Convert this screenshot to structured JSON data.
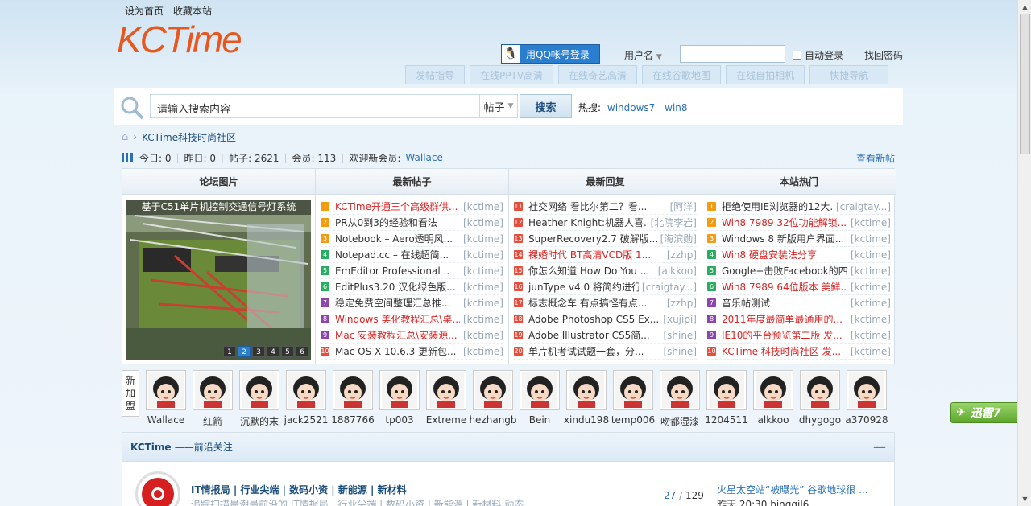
{
  "header": {
    "set_home": "设为首页",
    "bookmark": "收藏本站",
    "logo_text": "KCTime",
    "qq_login": "用QQ帐号登录",
    "username_label": "用户名",
    "auto_login": "自动登录",
    "find_password": "找回密码"
  },
  "nav": [
    "发帖指导",
    "在线PPTV高清",
    "在线奇艺高清",
    "在线谷歌地图",
    "在线自拍相机",
    "快捷导航"
  ],
  "search": {
    "placeholder": "请输入搜索内容",
    "type": "帖子",
    "button": "搜索",
    "hot_label": "热搜:",
    "hot_terms": [
      "windows7",
      "win8"
    ]
  },
  "breadcrumb": {
    "site": "KCTime科技时尚社区"
  },
  "stats": {
    "today": "今日: 0",
    "yesterday": "昨日: 0",
    "posts": "帖子: 2621",
    "members": "会员: 113",
    "welcome": "欢迎新会员:",
    "newest": "Wallace",
    "view_new": "查看新帖"
  },
  "columns": {
    "pictures": "论坛图片",
    "latest_posts": "最新帖子",
    "latest_replies": "最新回复",
    "hot": "本站热门"
  },
  "photo": {
    "caption": "基于C51单片机控制交通信号灯系统",
    "pages": [
      "1",
      "2",
      "3",
      "4",
      "5",
      "6"
    ]
  },
  "latest_posts": [
    {
      "n": "1",
      "title": "KCTime开通三个高级群供...",
      "author": "[kctime]",
      "red": true
    },
    {
      "n": "2",
      "title": "PR从0到3的经验和看法",
      "author": "[kctime]",
      "red": false
    },
    {
      "n": "3",
      "title": "Notebook – Aero透明风...",
      "author": "[kctime]",
      "red": false
    },
    {
      "n": "4",
      "title": "Notepad.cc – 在线超简...",
      "author": "[kctime]",
      "red": false
    },
    {
      "n": "5",
      "title": "EmEditor Professional ..",
      "author": "[kctime]",
      "red": false
    },
    {
      "n": "6",
      "title": "EditPlus3.20 汉化绿色版...",
      "author": "[kctime]",
      "red": false
    },
    {
      "n": "7",
      "title": "稳定免费空间整理汇总推...",
      "author": "[kctime]",
      "red": false
    },
    {
      "n": "8",
      "title": "Windows 美化教程汇总\\桌...",
      "author": "[kctime]",
      "red": true
    },
    {
      "n": "9",
      "title": "Mac 安装教程汇总\\安装源...",
      "author": "[kctime]",
      "red": true
    },
    {
      "n": "10",
      "title": "Mac OS X 10.6.3 更新包...",
      "author": "[kctime]",
      "red": false
    }
  ],
  "latest_replies": [
    {
      "n": "11",
      "title": "社交网络 看比尔第二？看...",
      "author": "[阿洋]",
      "red": false
    },
    {
      "n": "12",
      "title": "Heather Knight:机器人喜...",
      "author": "[北院李岩]",
      "red": false
    },
    {
      "n": "13",
      "title": "SuperRecovery2.7 破解版...",
      "author": "[海滨勋]",
      "red": false
    },
    {
      "n": "14",
      "title": "裸婚时代 BT高清VCD版 1...",
      "author": "[zzhp]",
      "red": true
    },
    {
      "n": "15",
      "title": "你怎么知道 How Do You ...",
      "author": "[alkkoo]",
      "red": false
    },
    {
      "n": "16",
      "title": "junType v4.0 将简约进行...",
      "author": "[craigtay...]",
      "red": false
    },
    {
      "n": "17",
      "title": "标志概念车 有点搞怪有点...",
      "author": "[zzhp]",
      "red": false
    },
    {
      "n": "18",
      "title": "Adobe Photoshop CS5 Ex...",
      "author": "[xujipi]",
      "red": false
    },
    {
      "n": "19",
      "title": "Adobe Illustrator CS5简...",
      "author": "[shine]",
      "red": false
    },
    {
      "n": "20",
      "title": "单片机考试试题一套，分...",
      "author": "[shine]",
      "red": false
    }
  ],
  "hot_posts": [
    {
      "n": "1",
      "title": "拒绝使用IE浏览器的12大...",
      "author": "[craigtay...]",
      "red": false
    },
    {
      "n": "2",
      "title": "Win8 7989 32位功能解锁...",
      "author": "[kctime]",
      "red": true
    },
    {
      "n": "3",
      "title": "Windows 8 新版用户界面...",
      "author": "[kctime]",
      "red": false
    },
    {
      "n": "4",
      "title": "Win8 硬盘安装法分享",
      "author": "[kctime]",
      "red": true
    },
    {
      "n": "5",
      "title": "Google+击败Facebook的四...",
      "author": "[kctime]",
      "red": false
    },
    {
      "n": "6",
      "title": "Win8 7989 64位版本 美鲜...",
      "author": "[kctime]",
      "red": true
    },
    {
      "n": "7",
      "title": "音乐帖测试",
      "author": "[kctime]",
      "red": false
    },
    {
      "n": "8",
      "title": "2011年度最简单最通用的...",
      "author": "[kctime]",
      "red": true
    },
    {
      "n": "9",
      "title": "IE10的平台预览第二版 发...",
      "author": "[kctime]",
      "red": true
    },
    {
      "n": "10",
      "title": "KCTime 科技时尚社区 发...",
      "author": "[kctime]",
      "red": true
    }
  ],
  "new_members_label": "新加盟",
  "members": [
    "Wallace",
    "红箭",
    "沉默的末",
    "jack2521",
    "1887766",
    "tp003",
    "Extreme",
    "hezhangb",
    "Bein",
    "xindu198",
    "temp006",
    "吻都湿漆",
    "1204511",
    "alkkoo",
    "dhygogo",
    "a370928"
  ],
  "forum_section": {
    "title": "KCTime",
    "subtitle": "——前沿关注",
    "collapse": "—",
    "subforums": "IT情报局 | 行业尖端 | 数码小资 | 新能源 | 新材料",
    "desc": "追踪扫描最潮最前沿的 IT情报局 | 行业尖端 | 数码小资 | 新能源 | 新材料 动态",
    "threads": "27",
    "sep": "/",
    "posts": "129",
    "last_title": "火星太空站“被曝光” 谷歌地球很 ...",
    "last_meta": "昨天 20:30 bingqil6"
  },
  "thunder": "迅雷7",
  "colors": {
    "accent": "#2a70b8",
    "logo": "#e8571e",
    "hot_red": "#d22"
  }
}
